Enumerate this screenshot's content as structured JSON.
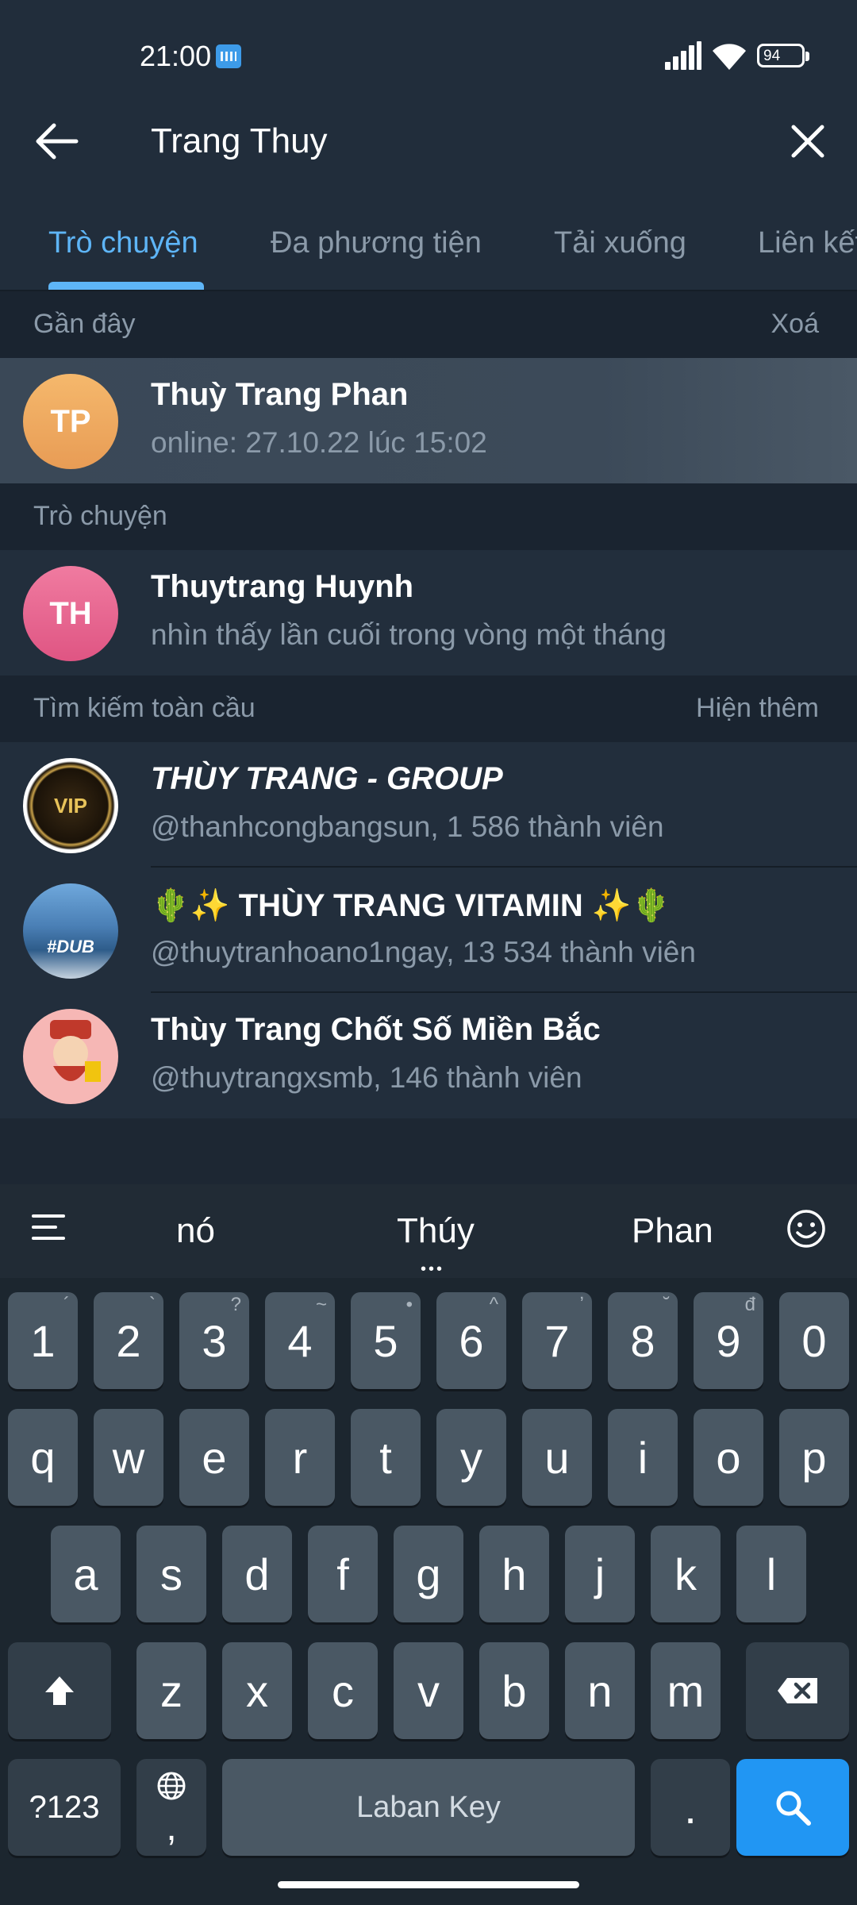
{
  "status_bar": {
    "time": "21:00",
    "battery": "94"
  },
  "search": {
    "query": "Trang Thuy"
  },
  "tabs": [
    {
      "label": "Trò chuyện"
    },
    {
      "label": "Đa phương tiện"
    },
    {
      "label": "Tải xuống"
    },
    {
      "label": "Liên kết"
    }
  ],
  "recent": {
    "title": "Gần đây",
    "action": "Xoá",
    "items": [
      {
        "initials": "TP",
        "name": "Thuỳ Trang Phan",
        "subtitle": "online: 27.10.22 lúc 15:02"
      }
    ]
  },
  "chats": {
    "title": "Trò chuyện",
    "items": [
      {
        "initials": "TH",
        "name": "Thuytrang Huynh",
        "subtitle": "nhìn thấy lần cuối trong vòng một tháng"
      }
    ]
  },
  "global": {
    "title": "Tìm kiếm toàn cầu",
    "action": "Hiện thêm",
    "items": [
      {
        "name": "THÙY TRANG - GROUP",
        "subtitle": "@thanhcongbangsun, 1 586 thành viên",
        "avatar_text": "VIP"
      },
      {
        "name": "🌵✨ THÙY TRANG VITAMIN ✨🌵",
        "subtitle": "@thuytranhoano1ngay, 13 534 thành viên",
        "avatar_text": "#DUB"
      },
      {
        "name": "Thùy Trang Chốt Số Miền Bắc",
        "subtitle": "@thuytrangxsmb, 146 thành viên"
      }
    ]
  },
  "keyboard": {
    "suggestions": [
      "nó",
      "Thúy",
      "Phan"
    ],
    "row_numbers": [
      "1",
      "2",
      "3",
      "4",
      "5",
      "6",
      "7",
      "8",
      "9",
      "0"
    ],
    "number_hints": [
      "´",
      "`",
      "?",
      "~",
      "•",
      "^",
      "ʼ",
      "˘",
      "đ",
      ""
    ],
    "row1": [
      "q",
      "w",
      "e",
      "r",
      "t",
      "y",
      "u",
      "i",
      "o",
      "p"
    ],
    "row2": [
      "a",
      "s",
      "d",
      "f",
      "g",
      "h",
      "j",
      "k",
      "l"
    ],
    "row3": [
      "z",
      "x",
      "c",
      "v",
      "b",
      "n",
      "m"
    ],
    "symbols_label": "?123",
    "comma_label": ",",
    "space_label": "Laban Key",
    "period_label": "."
  },
  "colors": {
    "accent": "#5eb5f7",
    "avatar_tp": "#f0a860",
    "avatar_th": "#e6628c",
    "search_key": "#2196f3"
  }
}
